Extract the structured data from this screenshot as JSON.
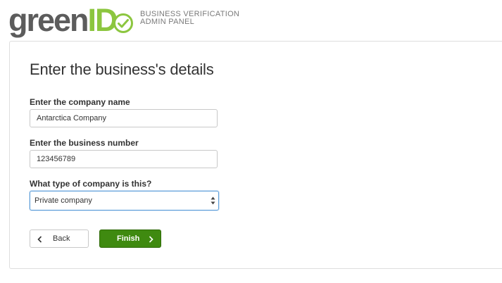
{
  "brand": {
    "logo_word_a": "green",
    "logo_word_b": "ID",
    "tagline_line1": "BUSINESS VERIFICATION",
    "tagline_line2": "ADMIN PANEL",
    "colors": {
      "wordmark_gray": "#5c5c5c",
      "accent_green": "#8cc63f"
    }
  },
  "form": {
    "title": "Enter the business's details",
    "company_name": {
      "label": "Enter the company name",
      "value": "Antarctica Company"
    },
    "business_number": {
      "label": "Enter the business number",
      "value": "123456789"
    },
    "company_type": {
      "label": "What type of company is this?",
      "selected": "Private company"
    }
  },
  "actions": {
    "back_label": "Back",
    "back_icon": "chevron-left-icon",
    "finish_label": "Finish",
    "finish_icon": "chevron-right-icon",
    "colors": {
      "finish_bg": "#3f8a10",
      "focus_border": "#5b9dd9"
    }
  }
}
